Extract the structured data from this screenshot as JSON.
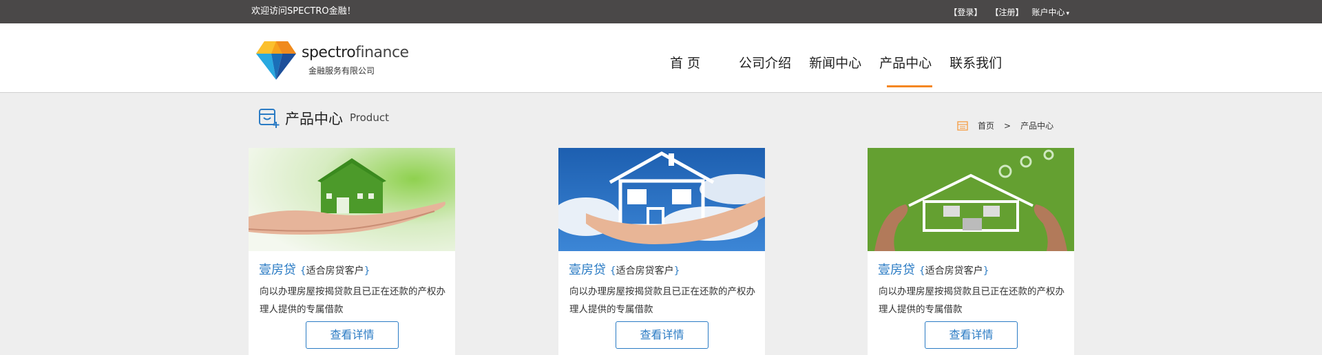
{
  "topbar": {
    "welcome": "欢迎访问SPECTRO金融！",
    "login": "【登录】",
    "register": "【注册】",
    "account": "账户中心",
    "account_caret": "▾"
  },
  "logo": {
    "brand_a": "spectro",
    "brand_b": "finance",
    "subtitle": "金融服务有限公司"
  },
  "nav": {
    "items": [
      {
        "label": "首 页"
      },
      {
        "label": "公司介绍"
      },
      {
        "label": "新闻中心"
      },
      {
        "label": "产品中心"
      },
      {
        "label": "联系我们"
      }
    ],
    "active_index": 3
  },
  "section": {
    "title": "产品中心",
    "subtitle_en": "Product"
  },
  "breadcrumb": {
    "home": "首页",
    "sep": ">",
    "current": "产品中心"
  },
  "cards": [
    {
      "title": "壹房贷",
      "open": "{",
      "tag": "适合房贷客户",
      "close": "}",
      "desc": "向以办理房屋按揭贷款且已正在还款的产权办理人提供的专属借款",
      "button": "查看详情"
    },
    {
      "title": "壹房贷",
      "open": "{",
      "tag": "适合房贷客户",
      "close": "}",
      "desc": "向以办理房屋按揭贷款且已正在还款的产权办理人提供的专属借款",
      "button": "查看详情"
    },
    {
      "title": "壹房贷",
      "open": "{",
      "tag": "适合房贷客户",
      "close": "}",
      "desc": "向以办理房屋按揭贷款且已正在还款的产权办理人提供的专属借款",
      "button": "查看详情"
    }
  ],
  "colors": {
    "topbar": "#4a4848",
    "accent_blue": "#2a7bc4",
    "active_underline": "#f5871f"
  }
}
